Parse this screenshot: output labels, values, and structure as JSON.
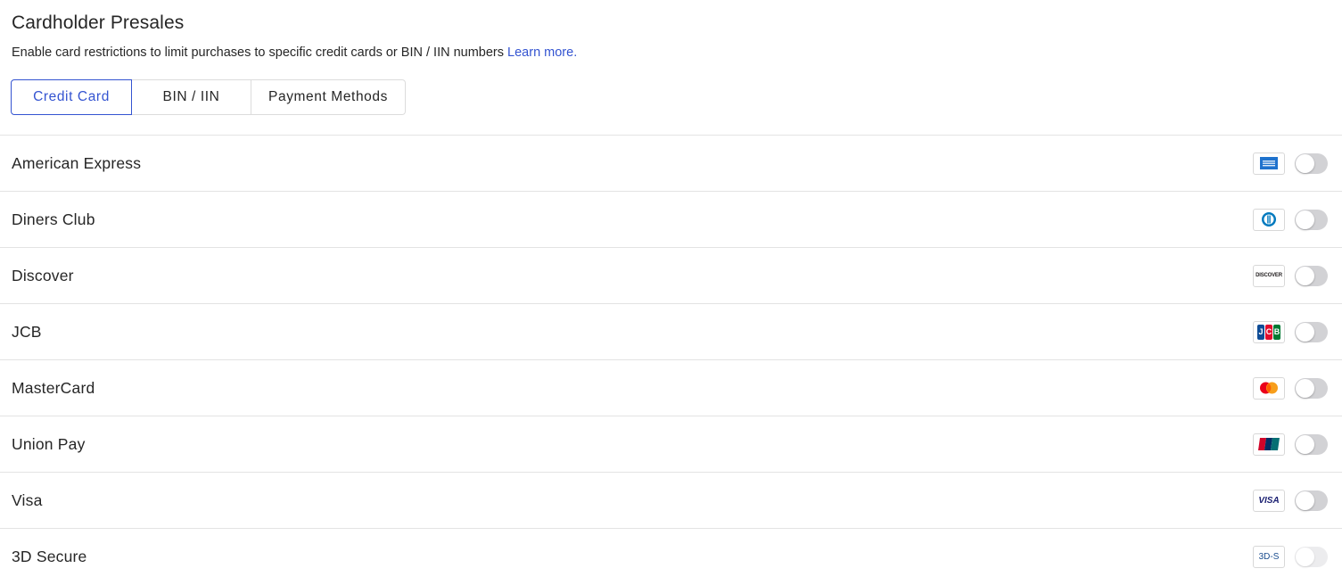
{
  "header": {
    "title": "Cardholder Presales",
    "description": "Enable card restrictions to limit purchases to specific credit cards or BIN / IIN numbers",
    "learn_more": "Learn more."
  },
  "tabs": [
    {
      "label": "Credit Card",
      "active": true
    },
    {
      "label": "BIN / IIN",
      "active": false
    },
    {
      "label": "Payment Methods",
      "active": false
    }
  ],
  "cards": [
    {
      "label": "American Express",
      "icon": "amex-icon",
      "enabled": false
    },
    {
      "label": "Diners Club",
      "icon": "diners-club-icon",
      "enabled": false
    },
    {
      "label": "Discover",
      "icon": "discover-icon",
      "icon_text": "DISCOVER",
      "enabled": false
    },
    {
      "label": "JCB",
      "icon": "jcb-icon",
      "icon_text": "JCB",
      "enabled": false
    },
    {
      "label": "MasterCard",
      "icon": "mastercard-icon",
      "enabled": false
    },
    {
      "label": "Union Pay",
      "icon": "unionpay-icon",
      "enabled": false
    },
    {
      "label": "Visa",
      "icon": "visa-icon",
      "icon_text": "VISA",
      "enabled": false
    },
    {
      "label": "3D Secure",
      "icon": "3d-secure-icon",
      "icon_text": "3D-S",
      "enabled": false,
      "disabled": true
    }
  ],
  "colors": {
    "accent": "#3454d1",
    "toggle_off": "#d2d2d5",
    "toggle_disabled": "#ececee"
  }
}
